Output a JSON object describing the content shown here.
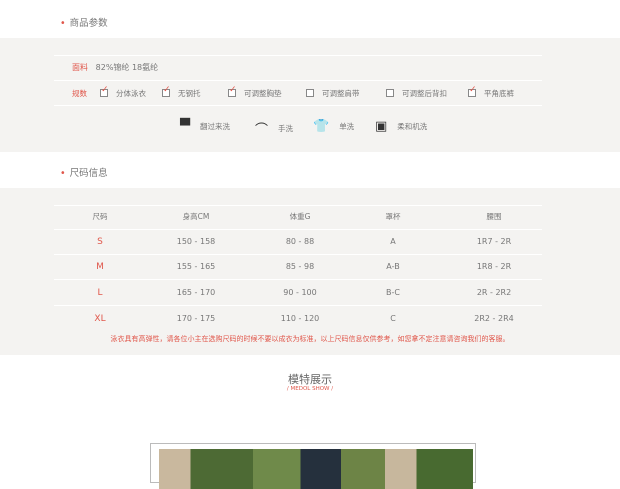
{
  "params": {
    "title": "商品参数",
    "material_label": "面料",
    "material_value": "82%锦纶  18氨纶",
    "spec_label": "规数",
    "options": [
      {
        "label": "分体泳衣",
        "checked": true
      },
      {
        "label": "无钢托",
        "checked": true
      },
      {
        "label": "可调整胸垫",
        "checked": true
      },
      {
        "label": "可调整肩带",
        "checked": false
      },
      {
        "label": "可调整后背扣",
        "checked": false
      },
      {
        "label": "平角底裤",
        "checked": true
      }
    ],
    "care": [
      {
        "icon": "turn-inside-out-icon",
        "label": "翻过来洗"
      },
      {
        "icon": "hand-wash-icon",
        "label": "手洗"
      },
      {
        "icon": "wash-separately-icon",
        "label": "单洗"
      },
      {
        "icon": "gentle-machine-wash-icon",
        "label": "柔和机洗"
      }
    ]
  },
  "size": {
    "title": "尺码信息",
    "headers": [
      "尺码",
      "身高CM",
      "体重G",
      "罩杯",
      "腰围"
    ],
    "rows": [
      [
        "S",
        "150 - 158",
        "80 - 88",
        "A",
        "1R7 - 2R"
      ],
      [
        "M",
        "155 - 165",
        "85 - 98",
        "A-B",
        "1R8 - 2R"
      ],
      [
        "L",
        "165 - 170",
        "90 - 100",
        "B-C",
        "2R - 2R2"
      ],
      [
        "XL",
        "170 - 175",
        "110 - 120",
        "C",
        "2R2 - 2R4"
      ]
    ],
    "note": "泳衣具有高弹性，请各位小主在选购尺码的时候不要以成衣为标准，以上尺码信息仅供参考，如您拿不定注意请咨询我们的客服。"
  },
  "model": {
    "title": "模特展示",
    "subtitle": "/ MEDOL SHOW /"
  },
  "colors": {
    "accent": "#e0564a",
    "bg_gray": "#f4f3f1"
  }
}
